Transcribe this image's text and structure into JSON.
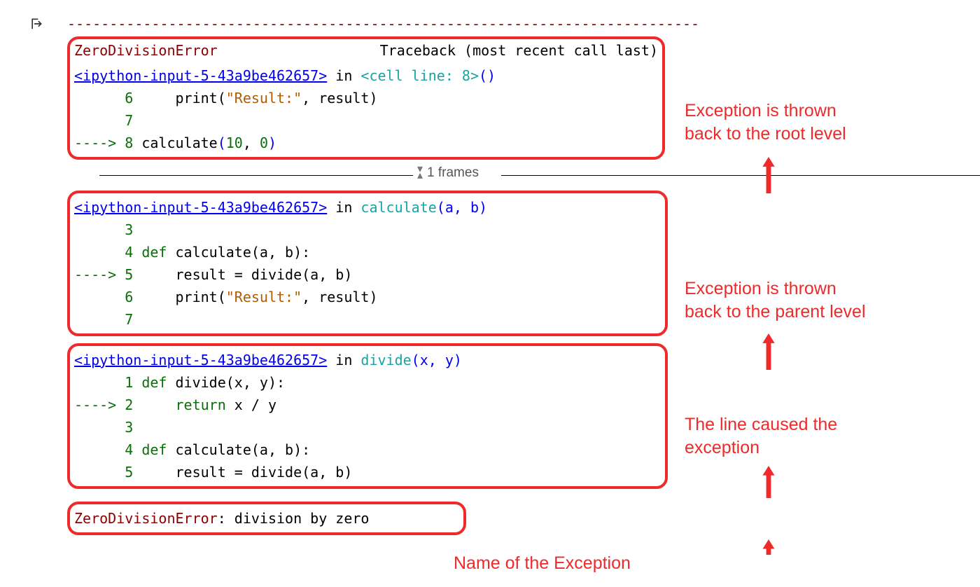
{
  "dash_line": "---------------------------------------------------------------------------",
  "header": {
    "error_name": "ZeroDivisionError",
    "traceback_label": "Traceback (most recent call last)"
  },
  "frames_label": "1 frames",
  "frame1": {
    "link": "<ipython-input-5-43a9be462657>",
    "in": " in ",
    "cell": "<cell line: 8>",
    "tail": "()",
    "l6_no": "      6 ",
    "l6_code_a": "    print(",
    "l6_str": "\"Result:\"",
    "l6_code_b": ", result)",
    "l7_no": "      7 ",
    "l8_arrow": "----> ",
    "l8_no": "8 ",
    "l8_call": "calculate",
    "l8_p1": "(",
    "l8_a1": "10",
    "l8_c": ", ",
    "l8_a2": "0",
    "l8_p2": ")"
  },
  "frame2": {
    "link": "<ipython-input-5-43a9be462657>",
    "in": " in ",
    "fn": "calculate",
    "sig": "(a, b)",
    "l3_no": "      3 ",
    "l4_no": "      4 ",
    "l4_def": "def",
    "l4_rest": " calculate(a, b):",
    "l5_arrow": "----> ",
    "l5_no": "5 ",
    "l5_rest": "    result = divide(a, b)",
    "l6_no": "      6 ",
    "l6_code_a": "    print(",
    "l6_str": "\"Result:\"",
    "l6_code_b": ", result)",
    "l7_no": "      7 "
  },
  "frame3": {
    "link": "<ipython-input-5-43a9be462657>",
    "in": " in ",
    "fn": "divide",
    "sig": "(x, y)",
    "l1_no": "      1 ",
    "l1_def": "def",
    "l1_rest": " divide(x, y):",
    "l2_arrow": "----> ",
    "l2_no": "2 ",
    "l2_ret": "    return",
    "l2_rest": " x / y",
    "l3_no": "      3 ",
    "l4_no": "      4 ",
    "l4_def": "def",
    "l4_rest": " calculate(a, b):",
    "l5_no": "      5 ",
    "l5_rest": "    result = divide(a, b)"
  },
  "final": {
    "name": "ZeroDivisionError",
    "msg": ": division by zero"
  },
  "annotations": {
    "a1": "Exception is thrown\nback to the root level",
    "a2": "Exception is thrown\nback to the parent level",
    "a3": "The line caused the\nexception",
    "a4": "Name of the Exception"
  }
}
